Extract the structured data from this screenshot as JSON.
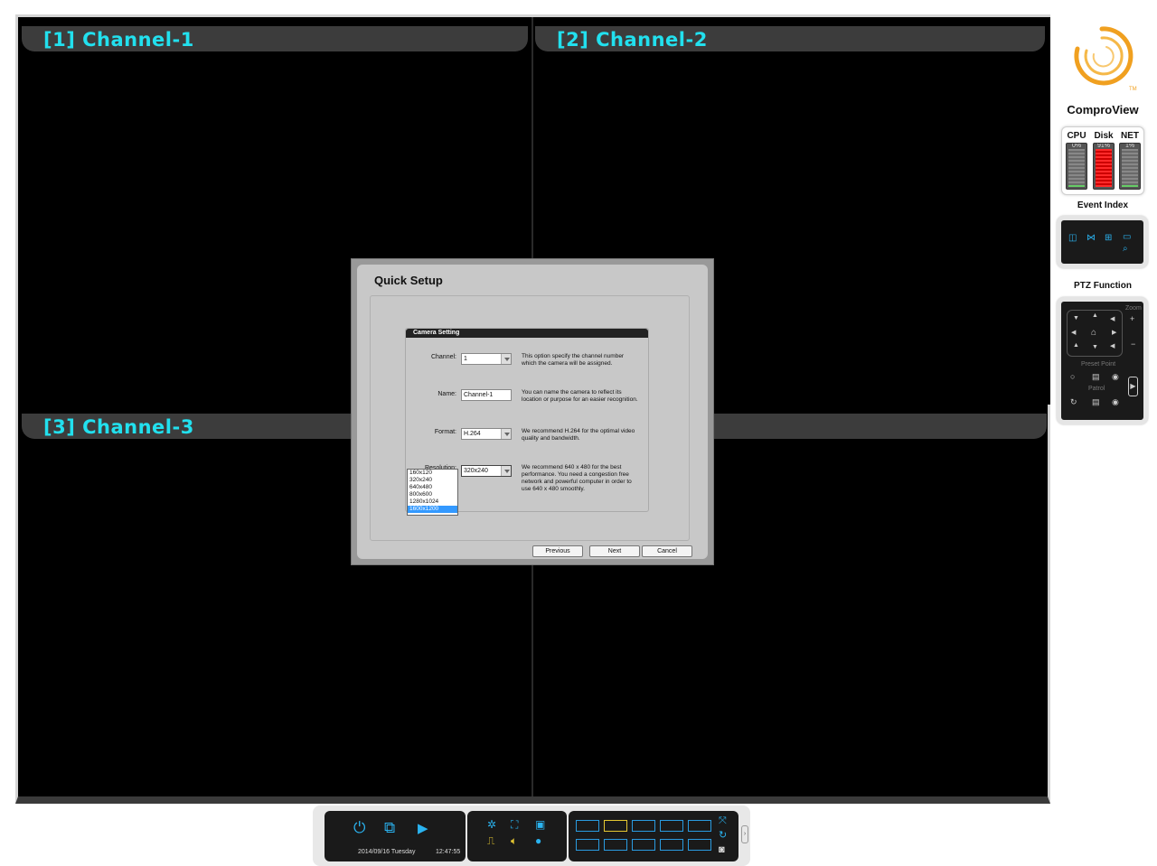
{
  "channels": [
    {
      "title": "[1] Channel-1"
    },
    {
      "title": "[2] Channel-2"
    },
    {
      "title": "[3] Channel-3"
    }
  ],
  "brand": "ComproView",
  "logo_tm": "TM",
  "meters": {
    "cpu": {
      "label": "CPU",
      "value": "0%",
      "fraction": 0.0
    },
    "disk": {
      "label": "Disk",
      "value": "91%",
      "fraction": 0.91
    },
    "net": {
      "label": "NET",
      "value": "1%",
      "fraction": 0.01
    }
  },
  "event_index": {
    "label": "Event Index"
  },
  "ptz": {
    "label": "PTZ Function",
    "zoom": "Zoom",
    "preset_point": "Preset Point",
    "patrol": "Patrol"
  },
  "dialog": {
    "title": "Quick Setup",
    "group_title": "Camera Setting",
    "channel": {
      "label": "Channel:",
      "value": "1",
      "help": "This option specify the channel number which the camera will be assigned."
    },
    "name": {
      "label": "Name:",
      "value": "Channel-1",
      "help": "You can name the camera to reflect its location or purpose for an easier recognition."
    },
    "format": {
      "label": "Format:",
      "value": "H.264",
      "help": "We recommend H.264 for the optimal video quality and bandwidth."
    },
    "resolution": {
      "label": "Resolution:",
      "value": "320x240",
      "help": "We recommend 640 x 480 for the best performance. You need a congestion free network and powerful computer in order to use 640 x 480 smoothly.",
      "options": [
        "160x120",
        "320x240",
        "640x480",
        "800x600",
        "1280x1024",
        "1600x1200"
      ],
      "highlighted": "1600x1200"
    },
    "buttons": {
      "previous": "Previous",
      "next": "Next",
      "cancel": "Cancel"
    }
  },
  "toolbar": {
    "date": "2014/09/16 Tuesday",
    "time": "12:47:55"
  },
  "colors": {
    "accent": "#2ab3f0",
    "channel_title": "#22e0ee",
    "disk_meter": "#ff2a2a",
    "logo": "#f0a020"
  }
}
